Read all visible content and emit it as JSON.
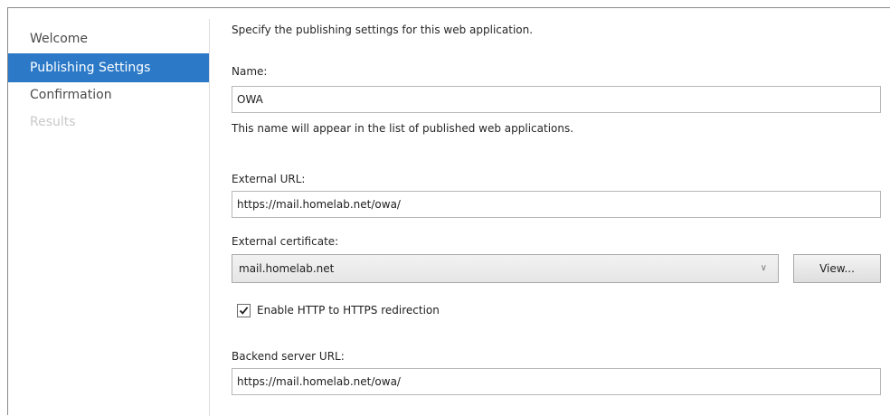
{
  "nav": {
    "items": [
      {
        "label": "Welcome"
      },
      {
        "label": "Publishing Settings"
      },
      {
        "label": "Confirmation"
      },
      {
        "label": "Results"
      }
    ]
  },
  "content": {
    "intro": "Specify the publishing settings for this web application.",
    "name_label": "Name:",
    "name_value": "OWA",
    "name_hint": "This name will appear in the list of published web applications.",
    "external_url_label": "External URL:",
    "external_url_value": "https://mail.homelab.net/owa/",
    "certificate_label": "External certificate:",
    "certificate_value": "mail.homelab.net",
    "view_button": "View...",
    "redirect_label": "Enable HTTP to HTTPS redirection",
    "redirect_checked": true,
    "backend_url_label": "Backend server URL:",
    "backend_url_value": "https://mail.homelab.net/owa/"
  }
}
